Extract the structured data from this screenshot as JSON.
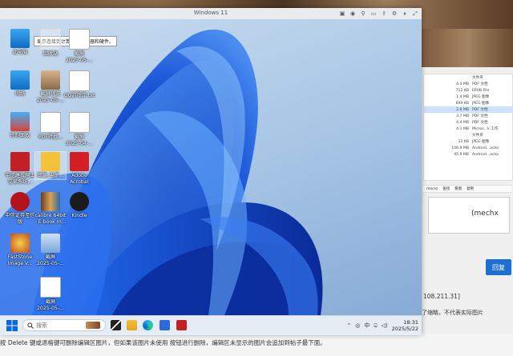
{
  "window": {
    "title": "Windows 11"
  },
  "tooltip": "显示连接到计算机的驱动器和硬件。",
  "desktop_icons": [
    {
      "label": "此电脑",
      "sub": ""
    },
    {
      "label": "回收站",
      "sub": ""
    },
    {
      "label": "截屏",
      "sub": "2025-05-..."
    },
    {
      "label": "网络",
      "sub": ""
    },
    {
      "label": "截屏预览",
      "sub": "2025-05-..."
    },
    {
      "label": "QQ游戏库.txt",
      "sub": ""
    },
    {
      "label": "控制面板",
      "sub": ""
    },
    {
      "label": "PDF转换...",
      "sub": ""
    },
    {
      "label": "截屏",
      "sub": "2025-04-..."
    },
    {
      "label": "中信建投网上",
      "sub": "交易系统..."
    },
    {
      "label": "资源_电子...",
      "sub": ""
    },
    {
      "label": "Adobe",
      "sub": "Acrobat"
    },
    {
      "label": "中信证券至信",
      "sub": "版"
    },
    {
      "label": "calibre 64bit",
      "sub": "- E-book m..."
    },
    {
      "label": "Kindle",
      "sub": ""
    },
    {
      "label": "FastStone",
      "sub": "Image V..."
    },
    {
      "label": "截屏",
      "sub": "2025-05-..."
    },
    {
      "label": "截屏",
      "sub": "2025-05-..."
    }
  ],
  "taskbar": {
    "search_placeholder": "搜索",
    "ime": "中",
    "time": "18:31",
    "date": "2025/5/22"
  },
  "host": {
    "reply_button": "回复",
    "ip_text": "108.211.31]",
    "quote_text": "(mechx",
    "bottom_message": "按 Delete 键或退格键可删除编辑区图片，但如果该图片未使用 按钮进行删除，编辑区未显示的图片会追加到帖子最下面。",
    "right_note": "了缩略，不代表实际图片",
    "files": [
      {
        "size": "",
        "type": "文件夹"
      },
      {
        "size": "4.4 MB",
        "type": "PDF 文档"
      },
      {
        "size": "712 KB",
        "type": "EPUB File"
      },
      {
        "size": "1.4 MB",
        "type": "JPEG 图像"
      },
      {
        "size": "699 KB",
        "type": "JPEG 图像"
      },
      {
        "size": "2.8 MB",
        "type": "PDF 文档"
      },
      {
        "size": "3.7 MB",
        "type": "PDF 文档"
      },
      {
        "size": "4.4 MB",
        "type": "PDF 文档"
      },
      {
        "size": "4.1 MB",
        "type": "Micros...k 工作"
      },
      {
        "size": "",
        "type": "文件夹"
      },
      {
        "size": "12 KB",
        "type": "JPEG 图像"
      },
      {
        "size": "106.9 MB",
        "type": "Android...acka"
      },
      {
        "size": "45.9 MB",
        "type": "Android...acka"
      }
    ],
    "toolbar_items": [
      "macro",
      "查找",
      "看图",
      "复制"
    ]
  },
  "colors": {
    "accent": "#1f6fd0",
    "taskbar_bg": "#e6ecf3"
  }
}
